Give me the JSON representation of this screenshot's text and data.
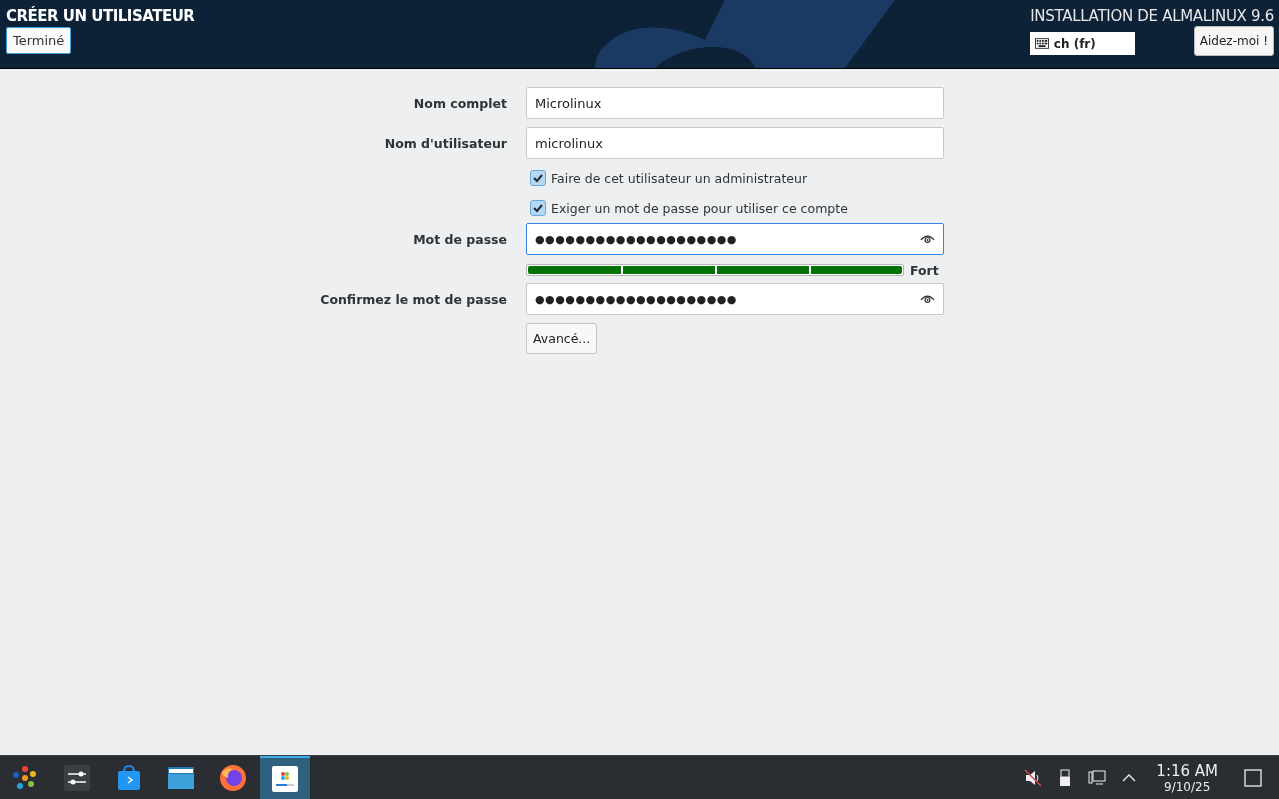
{
  "header": {
    "title": "CRÉER UN UTILISATEUR",
    "done_button": "Terminé",
    "product": "INSTALLATION DE ALMALINUX 9.6",
    "keyboard_layout": "ch (fr)",
    "help_button": "Aidez-moi !"
  },
  "form": {
    "rows": [
      {
        "kind": "text",
        "label": "Nom complet",
        "value": "Microlinux",
        "focused": false
      },
      {
        "kind": "text",
        "label": "Nom d'utilisateur",
        "value": "microlinux",
        "focused": false
      },
      {
        "kind": "checkbox",
        "label": "Faire de cet utilisateur un administrateur",
        "checked": true
      },
      {
        "kind": "checkbox",
        "label": "Exiger un mot de passe pour utiliser ce compte",
        "checked": true
      },
      {
        "kind": "password",
        "label": "Mot de passe",
        "value": "●●●●●●●●●●●●●●●●●●●●",
        "focused": true
      },
      {
        "kind": "meter",
        "level": 1,
        "reading": "Fort"
      },
      {
        "kind": "password",
        "label": "Confirmez le mot de passe",
        "value": "●●●●●●●●●●●●●●●●●●●●",
        "focused": false
      },
      {
        "kind": "button",
        "label": "Avancé..."
      }
    ]
  },
  "taskbar": {
    "apps": [
      {
        "kind": "launcher",
        "selected": false
      },
      {
        "kind": "settings",
        "selected": false
      },
      {
        "kind": "store",
        "selected": false
      },
      {
        "kind": "files",
        "selected": false
      },
      {
        "kind": "browser",
        "selected": false
      },
      {
        "kind": "installer",
        "selected": true
      }
    ],
    "time": "1:16 AM",
    "date": "9/10/25"
  }
}
